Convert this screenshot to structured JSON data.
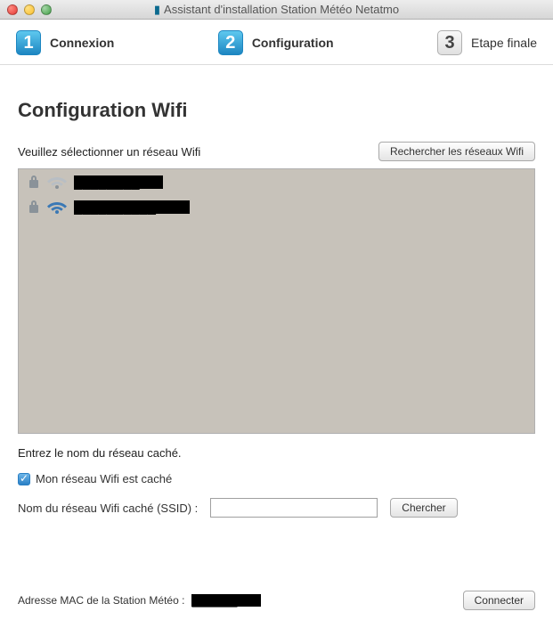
{
  "window_title": "Assistant d'installation Station Météo Netatmo",
  "steps": {
    "s1": {
      "num": "1",
      "label": "Connexion"
    },
    "s2": {
      "num": "2",
      "label": "Configuration"
    },
    "s3": {
      "num": "3",
      "label": "Etape finale"
    }
  },
  "page_title": "Configuration Wifi",
  "select_prompt": "Veuillez sélectionner un réseau Wifi",
  "search_button": "Rechercher les réseaux Wifi",
  "networks": [
    {
      "name": "████████",
      "locked": true,
      "signal": "weak"
    },
    {
      "name": "██████████",
      "locked": true,
      "signal": "strong"
    }
  ],
  "hidden_prompt": "Entrez le nom du réseau caché.",
  "hidden_checkbox_label": "Mon réseau Wifi est caché",
  "hidden_checked": true,
  "ssid_label": "Nom du réseau Wifi caché (SSID) :",
  "ssid_value": "",
  "ssid_search_button": "Chercher",
  "mac_label": "Adresse MAC de la Station Météo :",
  "mac_value": "██████",
  "connect_button": "Connecter"
}
